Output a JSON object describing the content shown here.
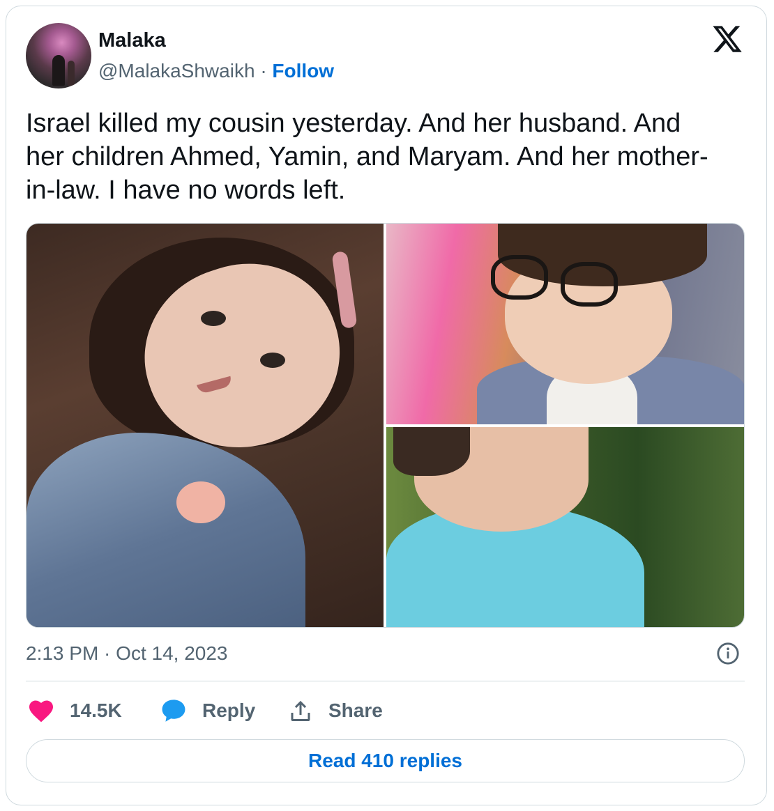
{
  "author": {
    "name": "Malaka",
    "handle": "@MalakaShwaikh",
    "separator": "·",
    "follow_label": "Follow"
  },
  "tweet": {
    "text": "Israel killed my cousin yesterday. And her husband. And\nher children Ahmed, Yamin, and Maryam. And her mother-\nin-law. I have no words left.",
    "timestamp": "2:13 PM · Oct 14, 2023"
  },
  "media": {
    "photo_count": 3
  },
  "actions": {
    "like_count": "14.5K",
    "reply_label": "Reply",
    "share_label": "Share"
  },
  "read_replies_label": "Read 410 replies",
  "icons": {
    "logo": "x-logo-icon",
    "like": "heart-icon",
    "reply": "speech-bubble-icon",
    "share": "share-upload-icon",
    "info": "info-icon"
  },
  "colors": {
    "accent": "#006fd6",
    "like": "#f91880",
    "reply": "#1d9bf0",
    "muted": "#536471",
    "border": "#cfd9de"
  }
}
